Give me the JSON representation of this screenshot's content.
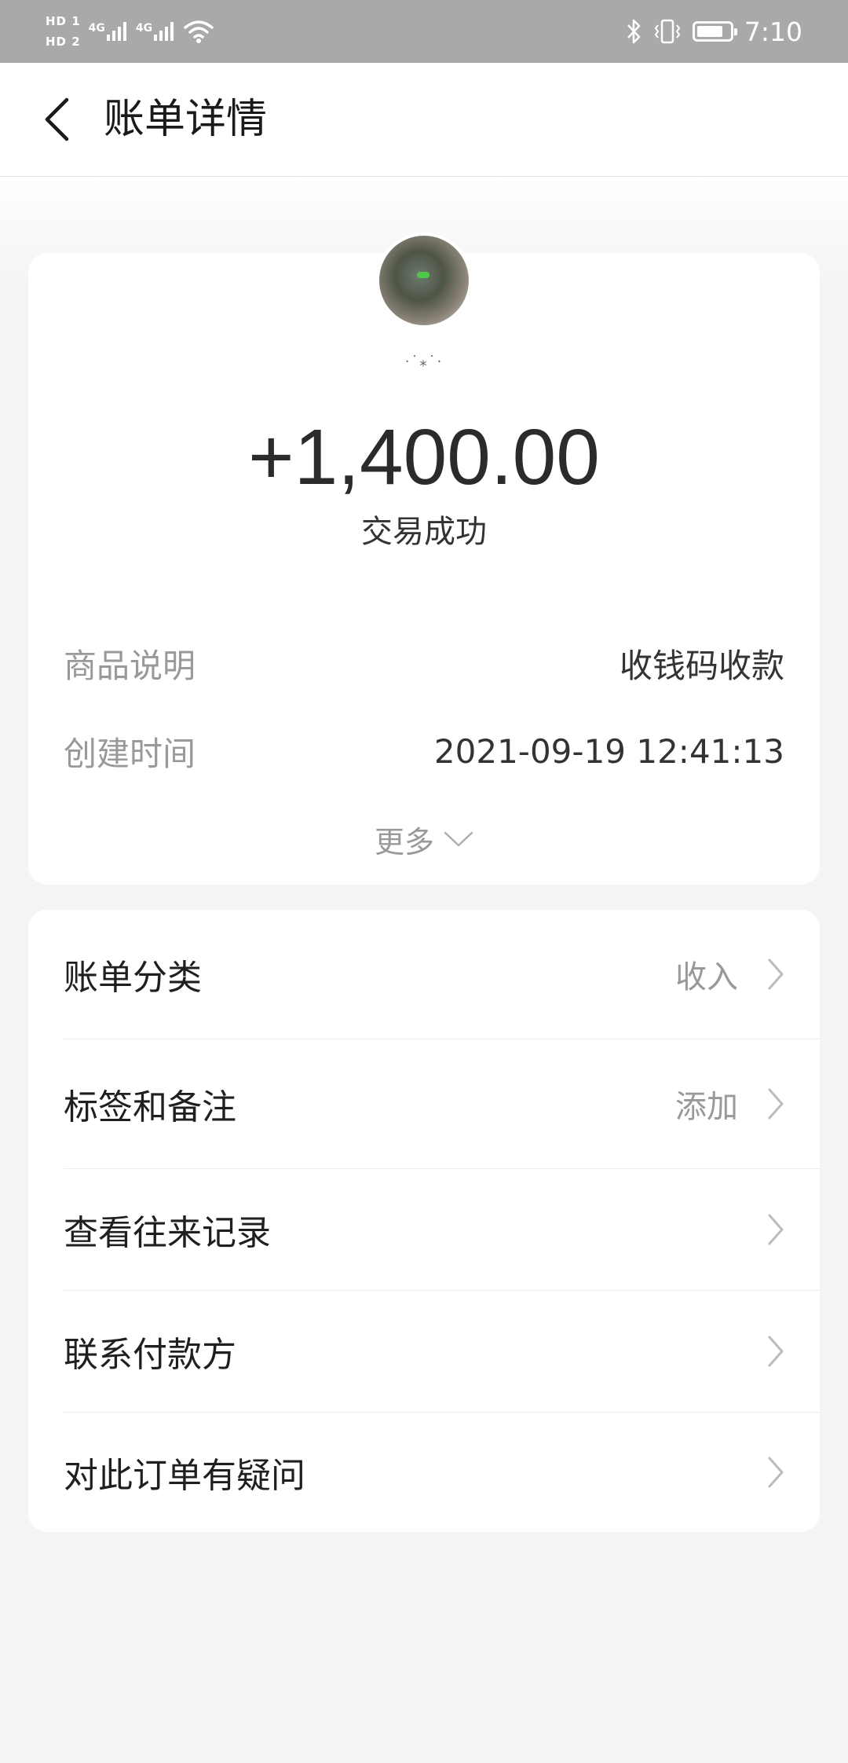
{
  "status_bar": {
    "hd1": "HD 1",
    "hd2": "HD 2",
    "net1": "4G",
    "net2": "4G",
    "time": "7:10",
    "battery_level": 0.8
  },
  "header": {
    "title": "账单详情"
  },
  "summary": {
    "amount": "+1,400.00",
    "status": "交易成功"
  },
  "details": [
    {
      "label": "商品说明",
      "value": "收钱码收款"
    },
    {
      "label": "创建时间",
      "value": "2021-09-19 12:41:13"
    }
  ],
  "more_label": "更多",
  "menu": [
    {
      "label": "账单分类",
      "value": "收入"
    },
    {
      "label": "标签和备注",
      "value": "添加"
    },
    {
      "label": "查看往来记录",
      "value": ""
    },
    {
      "label": "联系付款方",
      "value": ""
    },
    {
      "label": "对此订单有疑问",
      "value": ""
    }
  ]
}
